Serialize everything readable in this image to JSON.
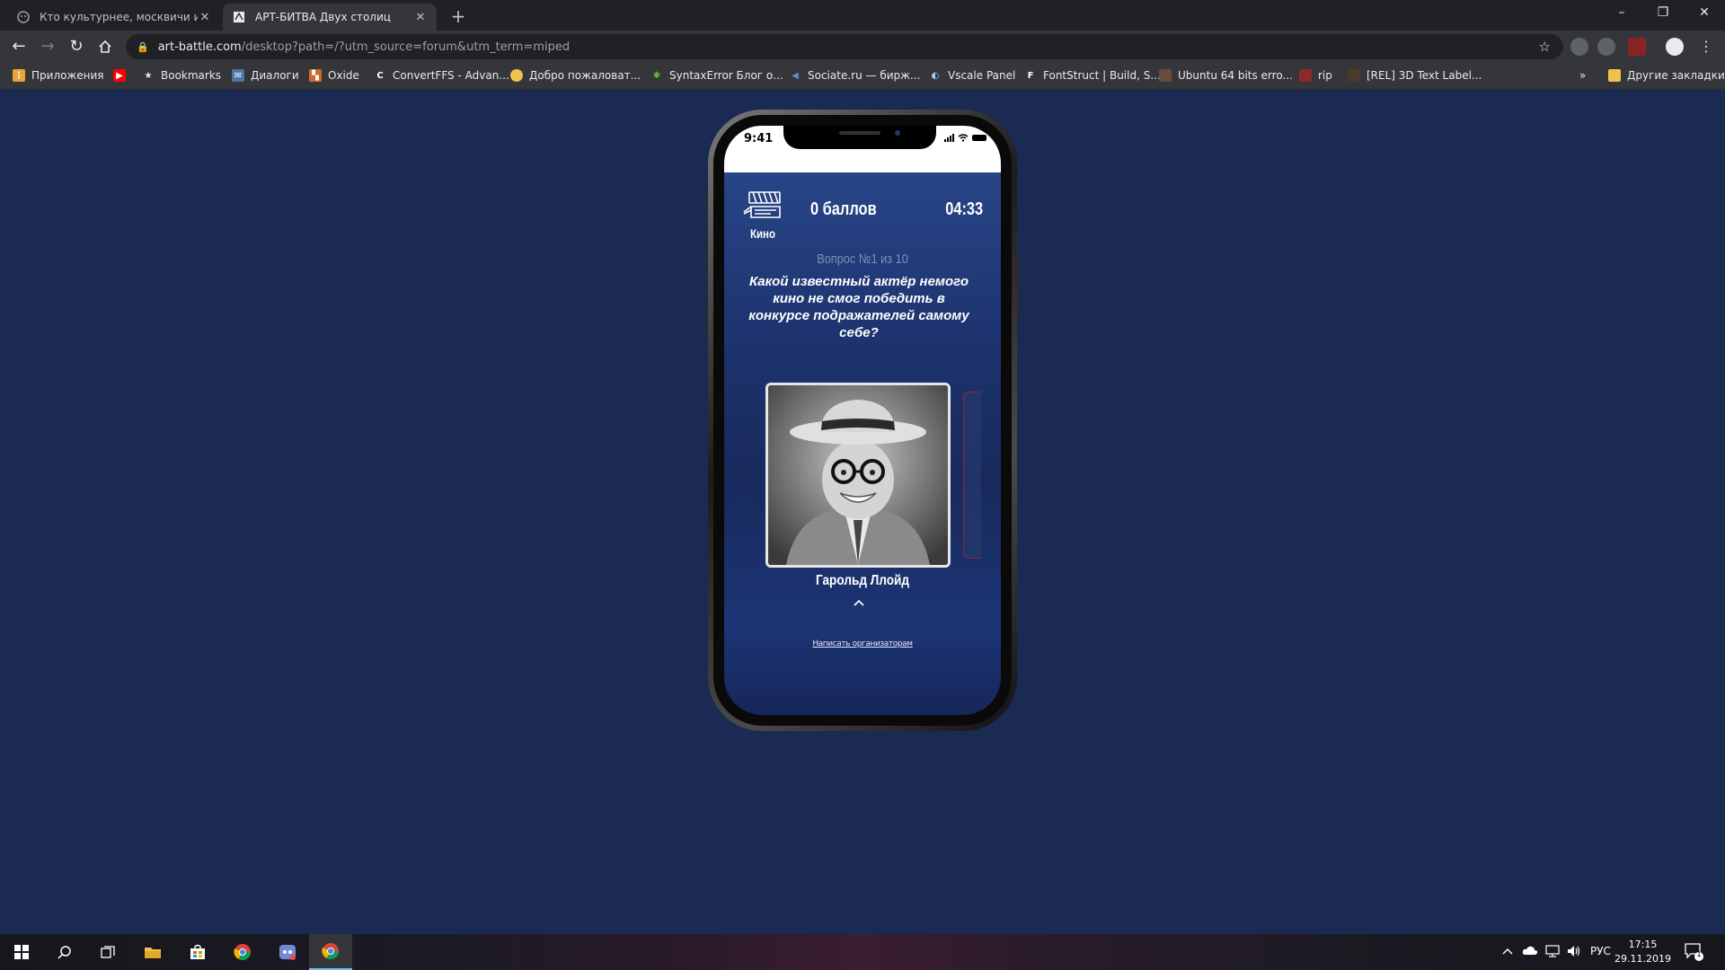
{
  "browser": {
    "tabs": [
      {
        "title": "Кто культурнее, москвичи или",
        "active": false
      },
      {
        "title": "АРТ-БИТВА Двух столиц",
        "active": true
      }
    ],
    "new_tab_label": "+",
    "window_controls": {
      "minimize": "–",
      "restore": "❐",
      "close": "✕"
    },
    "url_host": "art-battle.com",
    "url_path": "/desktop?path=/?utm_source=forum&utm_term=miped",
    "bookmarks": [
      {
        "label": "Приложения",
        "icon": "apps-grid-icon",
        "color": "#e8a33a"
      },
      {
        "label": "",
        "icon": "youtube-icon",
        "color": "#ff0000"
      },
      {
        "label": "Bookmarks",
        "icon": "star-icon",
        "color": "#e8eaed"
      },
      {
        "label": "Диалоги",
        "icon": "chat-icon",
        "color": "#4a76a8"
      },
      {
        "label": "Oxide",
        "icon": "oxide-icon",
        "color": "#cd6b2d"
      },
      {
        "label": "ConvertFFS - Advan...",
        "icon": "convert-icon",
        "color": "#35363a"
      },
      {
        "label": "Добро пожаловат...",
        "icon": "folder-icon",
        "color": "#f0c14b"
      },
      {
        "label": "SyntaxError Блог о...",
        "icon": "bug-icon",
        "color": "#5bc236"
      },
      {
        "label": "Sociate.ru — бирж...",
        "icon": "megaphone-icon",
        "color": "#5b8bd6"
      },
      {
        "label": "Vscale Panel",
        "icon": "vscale-icon",
        "color": "#35363a"
      },
      {
        "label": "FontStruct | Build, S...",
        "icon": "fontstruct-icon",
        "color": "#35363a"
      },
      {
        "label": "Ubuntu 64 bits erro...",
        "icon": "image-icon",
        "color": "#6a4a3a"
      },
      {
        "label": "rip",
        "icon": "rip-icon",
        "color": "#8a2a2a"
      },
      {
        "label": "[REL] 3D Text Label...",
        "icon": "forum-icon",
        "color": "#4a3a2a"
      }
    ],
    "bookmarks_overflow": "»",
    "other_bookmarks": "Другие закладки"
  },
  "phone": {
    "status_time": "9:41",
    "category": "Кино",
    "score": "0 баллов",
    "timer": "04:33",
    "question_number": "Вопрос №1 из 10",
    "question": "Какой известный актёр немого кино не смог победить в конкурсе подражателей самому себе?",
    "answer": "Гарольд Ллойд",
    "contact_link": "Написать организаторам"
  },
  "taskbar": {
    "language": "РУС",
    "time": "17:15",
    "date": "29.11.2019",
    "notifications": "1"
  }
}
